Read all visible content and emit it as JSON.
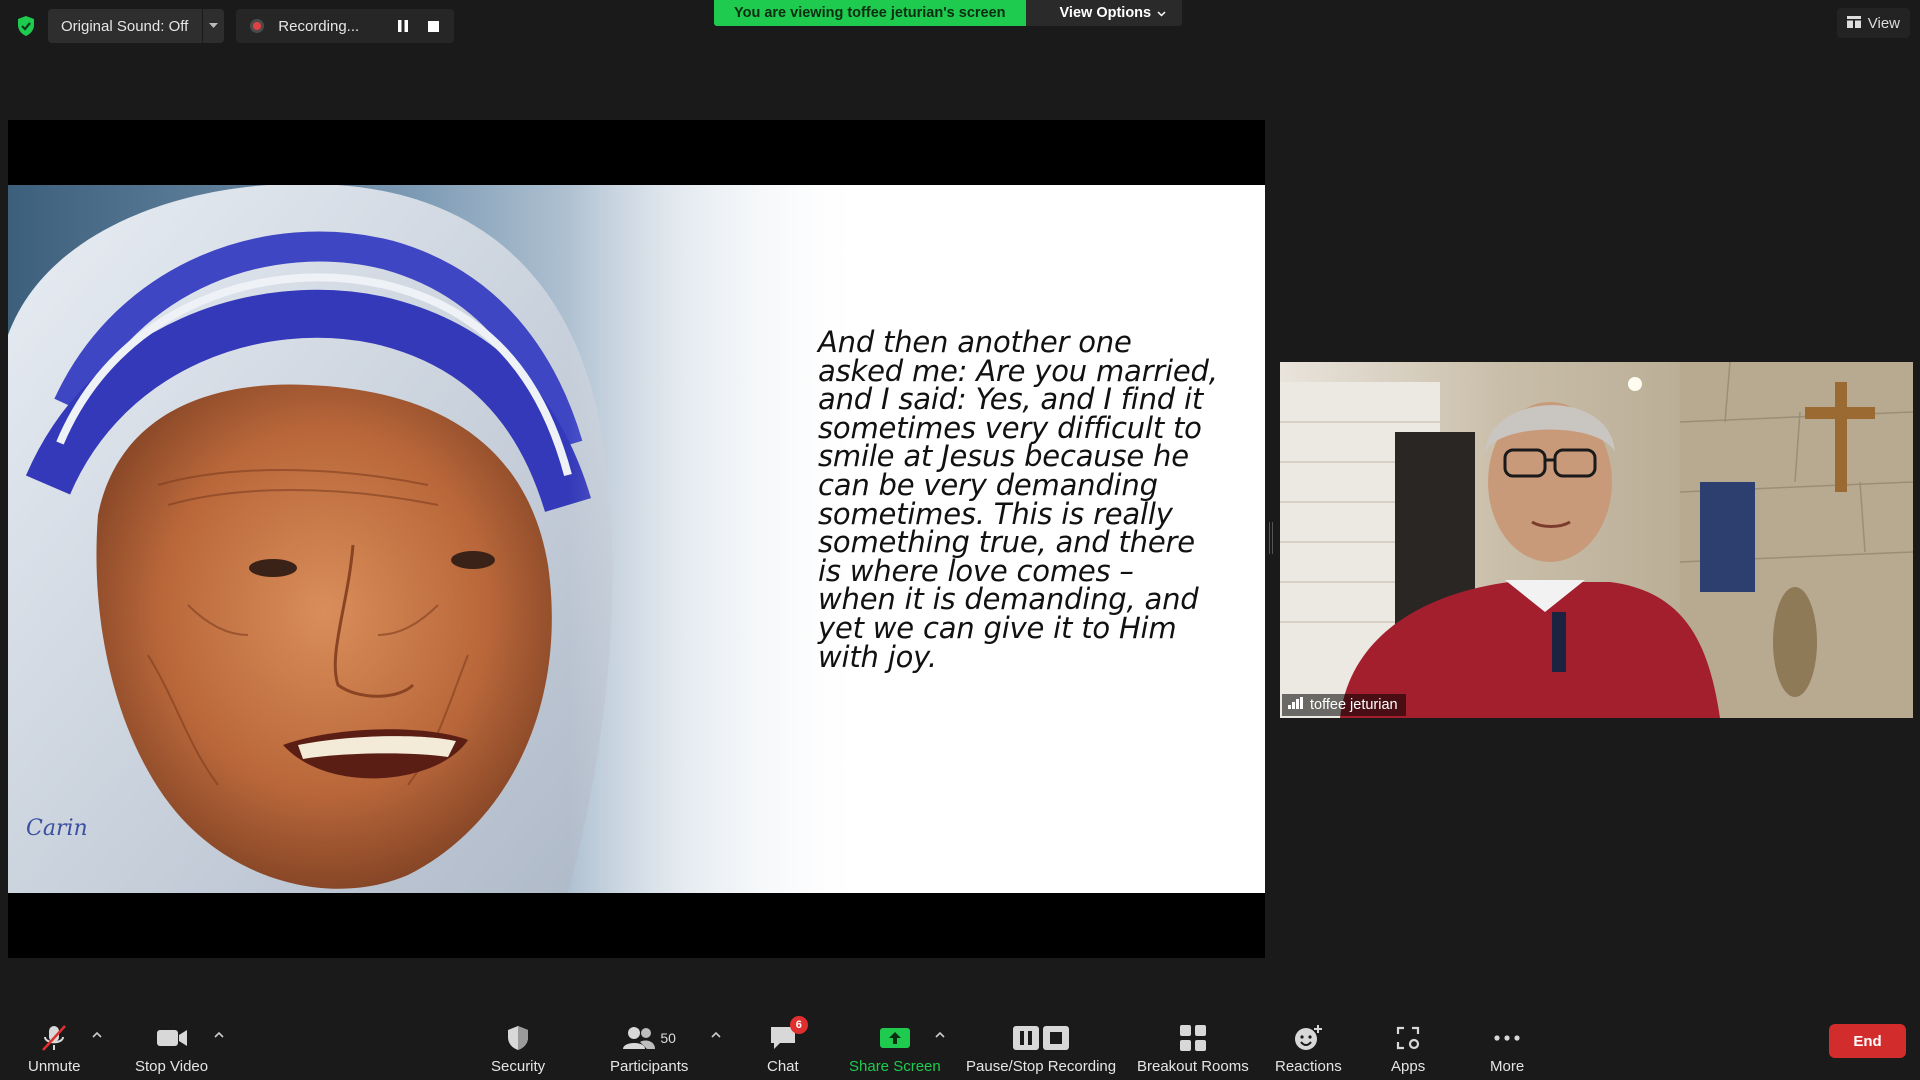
{
  "top_bar": {
    "original_sound_label": "Original Sound: Off",
    "recording_label": "Recording...",
    "viewing_banner": "You are viewing toffee jeturian's screen",
    "view_options_label": "View Options",
    "view_label": "View"
  },
  "slide": {
    "quote": "And then another one asked me: Are you married, and I said: Yes, and I find it sometimes very difficult to smile at Jesus because he can be very demanding sometimes. This is really something true, and there is where love comes – when it is demanding, and yet we can give it to Him with joy.",
    "signature": "Carin"
  },
  "participant": {
    "name": "toffee jeturian"
  },
  "toolbar": {
    "unmute": "Unmute",
    "stop_video": "Stop Video",
    "security": "Security",
    "participants": "Participants",
    "participants_count": "50",
    "chat": "Chat",
    "chat_badge": "6",
    "share_screen": "Share Screen",
    "pause_stop_recording": "Pause/Stop Recording",
    "breakout_rooms": "Breakout Rooms",
    "reactions": "Reactions",
    "apps": "Apps",
    "more": "More",
    "end": "End"
  },
  "colors": {
    "accent_green": "#1fcb4f",
    "end_red": "#d32c2c",
    "badge_red": "#e02f2f",
    "background": "#1a1a1a"
  },
  "icons": [
    "shield-check-icon",
    "chevron-down-icon",
    "record-icon",
    "pause-icon",
    "stop-icon",
    "grid-icon",
    "signal-bars-icon",
    "muted-mic-icon",
    "video-camera-icon",
    "shield-icon",
    "participants-icon",
    "chat-bubble-icon",
    "share-arrow-icon",
    "pause-stop-icon",
    "breakout-grid-icon",
    "reaction-smile-icon",
    "apps-icon",
    "ellipsis-icon"
  ]
}
